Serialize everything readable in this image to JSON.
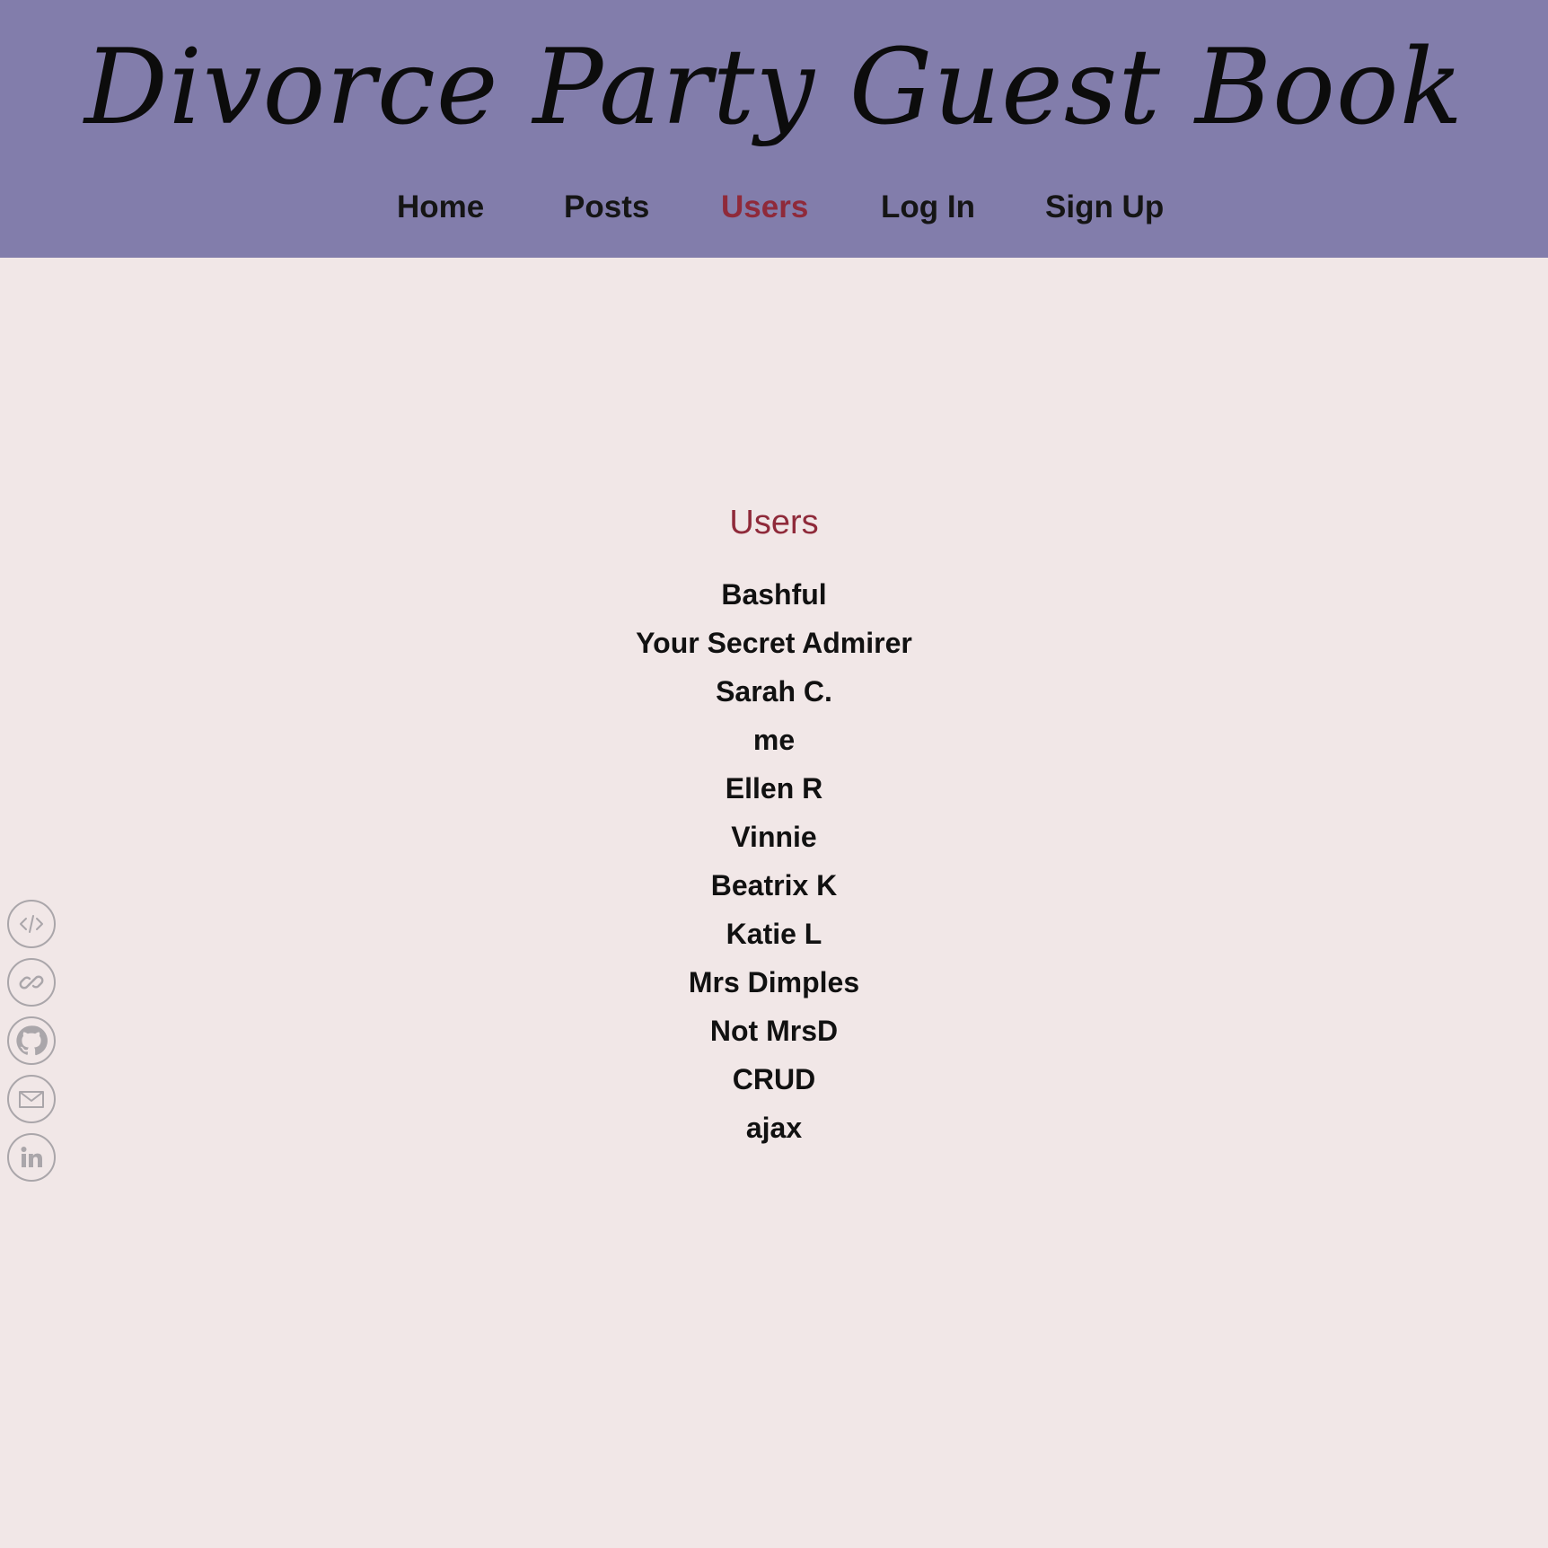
{
  "site": {
    "title": "Divorce Party Guest Book"
  },
  "nav": {
    "items": [
      {
        "label": "Home",
        "active": false
      },
      {
        "label": "Posts",
        "active": false
      },
      {
        "label": "Users",
        "active": true
      },
      {
        "label": "Log In",
        "active": false
      },
      {
        "label": "Sign Up",
        "active": false
      }
    ]
  },
  "main": {
    "heading": "Users",
    "users": [
      "Bashful",
      "Your Secret Admirer",
      "Sarah C.",
      "me",
      "Ellen R",
      "Vinnie",
      "Beatrix K",
      "Katie L",
      "Mrs Dimples",
      "Not MrsD",
      "CRUD",
      "ajax"
    ]
  },
  "social": {
    "icons": [
      "code-icon",
      "link-icon",
      "github-icon",
      "mail-icon",
      "linkedin-icon"
    ]
  },
  "colors": {
    "header_bg": "#827dab",
    "page_bg": "#f1e7e7",
    "accent": "#8f2a3a",
    "icon_gray": "#aaa6aa"
  }
}
